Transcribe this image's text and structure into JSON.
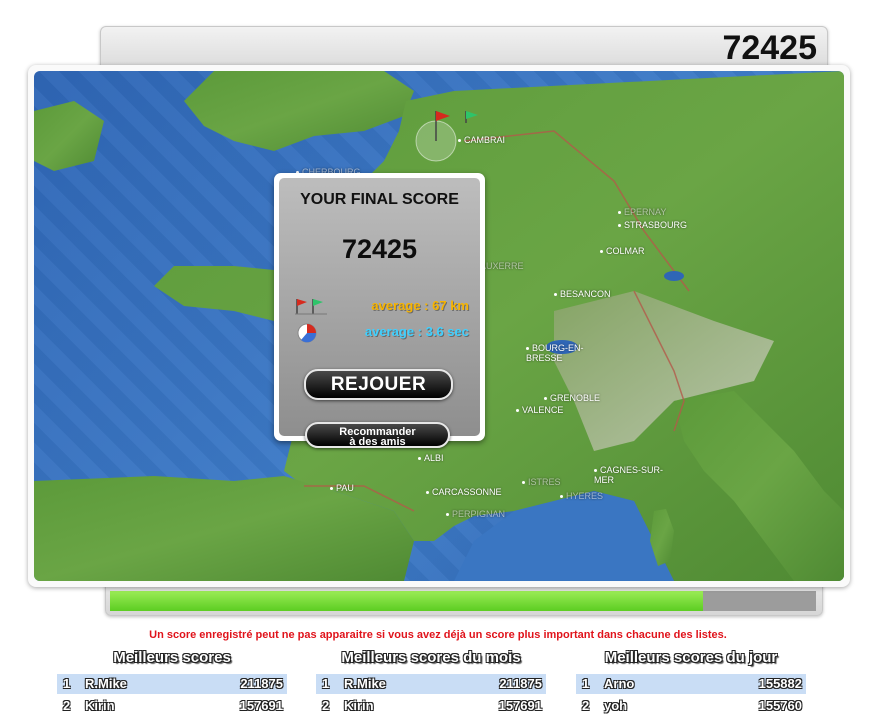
{
  "header": {
    "score": "72425"
  },
  "timer": {
    "remaining_fraction": 0.84
  },
  "map": {
    "cities": [
      {
        "name": "CAMBRAI",
        "faded": false
      },
      {
        "name": "CHERBOURG",
        "faded": true
      },
      {
        "name": "EPERNAY",
        "faded": true
      },
      {
        "name": "STRASBOURG",
        "faded": false
      },
      {
        "name": "COLMAR",
        "faded": false
      },
      {
        "name": "AUXERRE",
        "faded": true
      },
      {
        "name": "BESANCON",
        "faded": false
      },
      {
        "name": "BOURG-EN-\nBRESSE",
        "faded": false
      },
      {
        "name": "GRENOBLE",
        "faded": false
      },
      {
        "name": "VALENCE",
        "faded": false
      },
      {
        "name": "ALBI",
        "faded": false
      },
      {
        "name": "PAU",
        "faded": false
      },
      {
        "name": "CARCASSONNE",
        "faded": false
      },
      {
        "name": "ISTRES",
        "faded": true
      },
      {
        "name": "HYERES",
        "faded": true
      },
      {
        "name": "CAGNES-SUR-\nMER",
        "faded": false
      },
      {
        "name": "PERPIGNAN",
        "faded": true
      }
    ]
  },
  "popup": {
    "title": "YOUR FINAL SCORE",
    "score": "72425",
    "distance": {
      "text": "average : 67 km",
      "color": "#f7b400",
      "icon": "flags-icon"
    },
    "time": {
      "text": "average : 3.6 sec",
      "color": "#3fd0ff",
      "icon": "clock-icon"
    },
    "replay_label": "REJOUER",
    "recommend_label": "Recommander\nà des amis"
  },
  "notice": "Un score enregistré peut ne pas apparaitre si vous avez déjà un score plus important dans chacune des listes.",
  "leaderboards": [
    {
      "title": "Meilleurs scores",
      "rows": [
        {
          "rank": "1",
          "name": "R.Mike",
          "score": "211875"
        },
        {
          "rank": "2",
          "name": "Kirin",
          "score": "157691"
        }
      ]
    },
    {
      "title": "Meilleurs scores du mois",
      "rows": [
        {
          "rank": "1",
          "name": "R.Mike",
          "score": "211875"
        },
        {
          "rank": "2",
          "name": "Kirin",
          "score": "157691"
        }
      ]
    },
    {
      "title": "Meilleurs scores du jour",
      "rows": [
        {
          "rank": "1",
          "name": "Arno",
          "score": "155882"
        },
        {
          "rank": "2",
          "name": "yoh",
          "score": "155760"
        }
      ]
    }
  ]
}
